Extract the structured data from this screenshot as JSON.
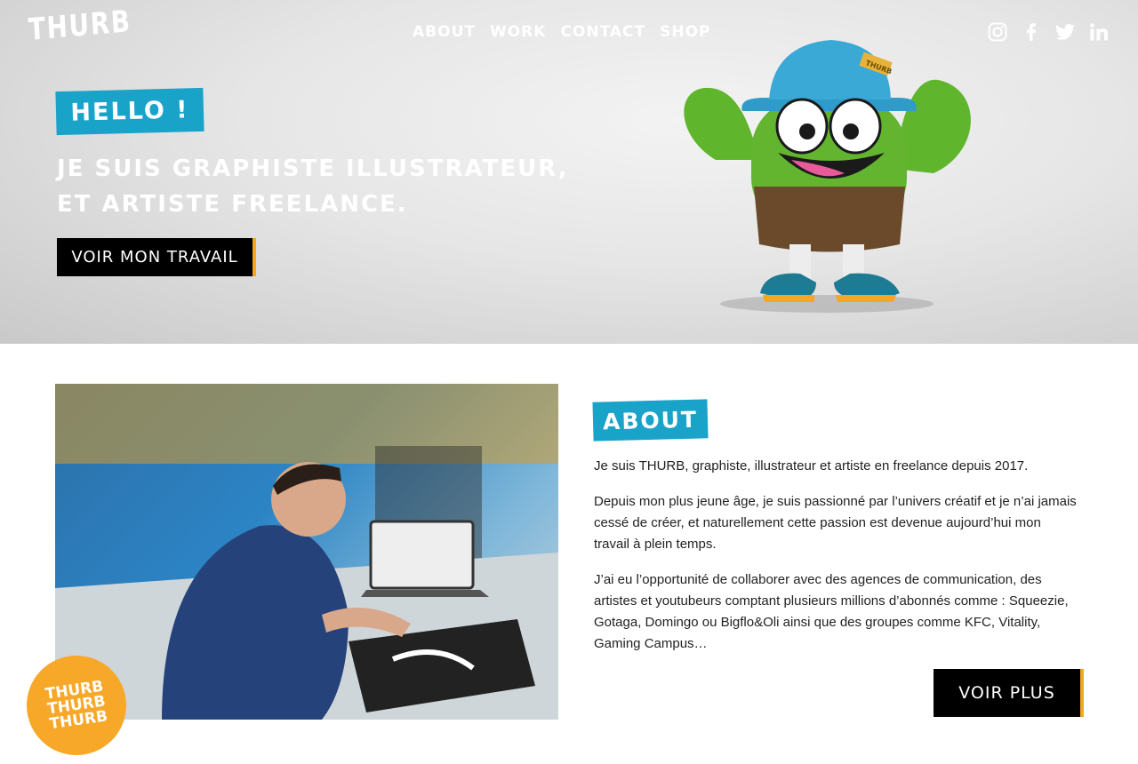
{
  "brand": {
    "logo_text": "THURB"
  },
  "nav": {
    "items": [
      "ABOUT",
      "WORK",
      "CONTACT",
      "SHOP"
    ]
  },
  "social": {
    "icons": [
      "instagram-icon",
      "facebook-icon",
      "twitter-icon",
      "linkedin-icon"
    ]
  },
  "hero": {
    "tag": "HELLO !",
    "headline_line1": "JE SUIS GRAPHISTE ILLUSTRATEUR,",
    "headline_line2": "ET ARTISTE FREELANCE.",
    "cta": "VOIR MON TRAVAIL",
    "mascot_hat_label": "THURB"
  },
  "about": {
    "tag": "ABOUT",
    "paragraphs": [
      "Je suis THURB, graphiste, illustrateur et artiste en freelance depuis 2017.",
      "Depuis mon plus jeune âge, je suis passionné par l’univers créatif et je n’ai jamais cessé de créer, et naturellement cette passion est devenue aujourd’hui mon travail à plein temps.",
      "J’ai eu l’opportunité de collaborer avec des agences de communication, des artistes et youtubeurs comptant plusieurs millions d’abonnés comme : Squeezie, Gotaga, Domingo ou Bigflo&Oli ainsi que des groupes comme KFC, Vitality, Gaming Campus…"
    ],
    "cta": "VOIR PLUS"
  },
  "sticker": {
    "lines": [
      "THURB",
      "THURB",
      "THURB"
    ]
  },
  "colors": {
    "accent_blue": "#1aa3c9",
    "accent_orange": "#f5a623",
    "button_black": "#000000",
    "mascot_green": "#5fb52c"
  }
}
